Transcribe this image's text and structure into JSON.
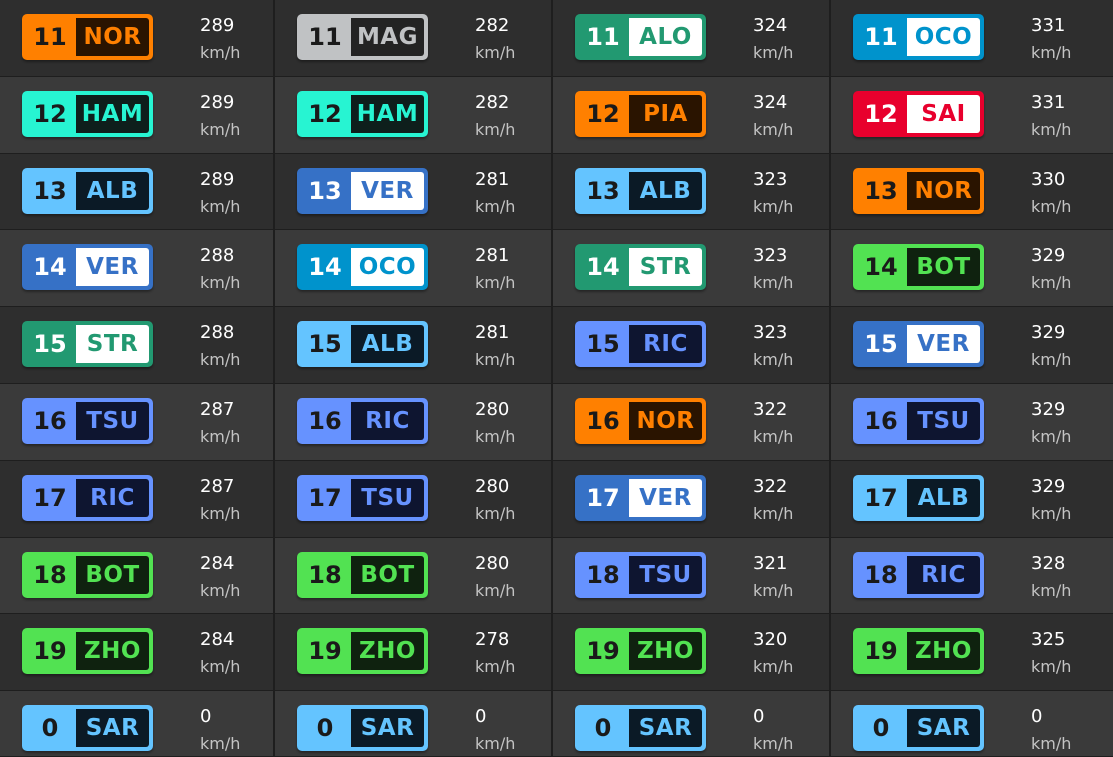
{
  "speed_unit": "km/h",
  "teams": {
    "mclaren": {
      "bg": "#ff8000",
      "code_bg": "#2a1400",
      "code_color": "#ff8000",
      "pos_color": "#1a1a1a"
    },
    "haas": {
      "bg": "#c0c2c4",
      "code_bg": "#232323",
      "code_color": "#c0c2c4",
      "pos_color": "#1a1a1a"
    },
    "aston": {
      "bg": "#229971",
      "code_bg": "#ffffff",
      "code_color": "#229971",
      "pos_color": "#ffffff"
    },
    "alpine": {
      "bg": "#0093cc",
      "code_bg": "#ffffff",
      "code_color": "#0093cc",
      "pos_color": "#ffffff"
    },
    "mercedes": {
      "bg": "#27f4d2",
      "code_bg": "#0e1f1c",
      "code_color": "#27f4d2",
      "pos_color": "#1a1a1a"
    },
    "ferrari": {
      "bg": "#e8002d",
      "code_bg": "#ffffff",
      "code_color": "#e8002d",
      "pos_color": "#ffffff"
    },
    "williams": {
      "bg": "#64c4ff",
      "code_bg": "#0b1a26",
      "code_color": "#64c4ff",
      "pos_color": "#1a1a1a"
    },
    "redbull": {
      "bg": "#3671c6",
      "code_bg": "#ffffff",
      "code_color": "#3671c6",
      "pos_color": "#ffffff"
    },
    "rb": {
      "bg": "#6692ff",
      "code_bg": "#0e1530",
      "code_color": "#6692ff",
      "pos_color": "#1a1a1a"
    },
    "sauber": {
      "bg": "#52e252",
      "code_bg": "#0f220f",
      "code_color": "#52e252",
      "pos_color": "#1a1a1a"
    }
  },
  "columns": [
    [
      {
        "pos": "11",
        "code": "NOR",
        "speed": "289",
        "team": "mclaren"
      },
      {
        "pos": "12",
        "code": "HAM",
        "speed": "289",
        "team": "mercedes"
      },
      {
        "pos": "13",
        "code": "ALB",
        "speed": "289",
        "team": "williams"
      },
      {
        "pos": "14",
        "code": "VER",
        "speed": "288",
        "team": "redbull"
      },
      {
        "pos": "15",
        "code": "STR",
        "speed": "288",
        "team": "aston"
      },
      {
        "pos": "16",
        "code": "TSU",
        "speed": "287",
        "team": "rb"
      },
      {
        "pos": "17",
        "code": "RIC",
        "speed": "287",
        "team": "rb"
      },
      {
        "pos": "18",
        "code": "BOT",
        "speed": "284",
        "team": "sauber"
      },
      {
        "pos": "19",
        "code": "ZHO",
        "speed": "284",
        "team": "sauber"
      },
      {
        "pos": "0",
        "code": "SAR",
        "speed": "0",
        "team": "williams"
      }
    ],
    [
      {
        "pos": "11",
        "code": "MAG",
        "speed": "282",
        "team": "haas"
      },
      {
        "pos": "12",
        "code": "HAM",
        "speed": "282",
        "team": "mercedes"
      },
      {
        "pos": "13",
        "code": "VER",
        "speed": "281",
        "team": "redbull"
      },
      {
        "pos": "14",
        "code": "OCO",
        "speed": "281",
        "team": "alpine"
      },
      {
        "pos": "15",
        "code": "ALB",
        "speed": "281",
        "team": "williams"
      },
      {
        "pos": "16",
        "code": "RIC",
        "speed": "280",
        "team": "rb"
      },
      {
        "pos": "17",
        "code": "TSU",
        "speed": "280",
        "team": "rb"
      },
      {
        "pos": "18",
        "code": "BOT",
        "speed": "280",
        "team": "sauber"
      },
      {
        "pos": "19",
        "code": "ZHO",
        "speed": "278",
        "team": "sauber"
      },
      {
        "pos": "0",
        "code": "SAR",
        "speed": "0",
        "team": "williams"
      }
    ],
    [
      {
        "pos": "11",
        "code": "ALO",
        "speed": "324",
        "team": "aston"
      },
      {
        "pos": "12",
        "code": "PIA",
        "speed": "324",
        "team": "mclaren"
      },
      {
        "pos": "13",
        "code": "ALB",
        "speed": "323",
        "team": "williams"
      },
      {
        "pos": "14",
        "code": "STR",
        "speed": "323",
        "team": "aston"
      },
      {
        "pos": "15",
        "code": "RIC",
        "speed": "323",
        "team": "rb"
      },
      {
        "pos": "16",
        "code": "NOR",
        "speed": "322",
        "team": "mclaren"
      },
      {
        "pos": "17",
        "code": "VER",
        "speed": "322",
        "team": "redbull"
      },
      {
        "pos": "18",
        "code": "TSU",
        "speed": "321",
        "team": "rb"
      },
      {
        "pos": "19",
        "code": "ZHO",
        "speed": "320",
        "team": "sauber"
      },
      {
        "pos": "0",
        "code": "SAR",
        "speed": "0",
        "team": "williams"
      }
    ],
    [
      {
        "pos": "11",
        "code": "OCO",
        "speed": "331",
        "team": "alpine"
      },
      {
        "pos": "12",
        "code": "SAI",
        "speed": "331",
        "team": "ferrari"
      },
      {
        "pos": "13",
        "code": "NOR",
        "speed": "330",
        "team": "mclaren"
      },
      {
        "pos": "14",
        "code": "BOT",
        "speed": "329",
        "team": "sauber"
      },
      {
        "pos": "15",
        "code": "VER",
        "speed": "329",
        "team": "redbull"
      },
      {
        "pos": "16",
        "code": "TSU",
        "speed": "329",
        "team": "rb"
      },
      {
        "pos": "17",
        "code": "ALB",
        "speed": "329",
        "team": "williams"
      },
      {
        "pos": "18",
        "code": "RIC",
        "speed": "328",
        "team": "rb"
      },
      {
        "pos": "19",
        "code": "ZHO",
        "speed": "325",
        "team": "sauber"
      },
      {
        "pos": "0",
        "code": "SAR",
        "speed": "0",
        "team": "williams"
      }
    ]
  ]
}
